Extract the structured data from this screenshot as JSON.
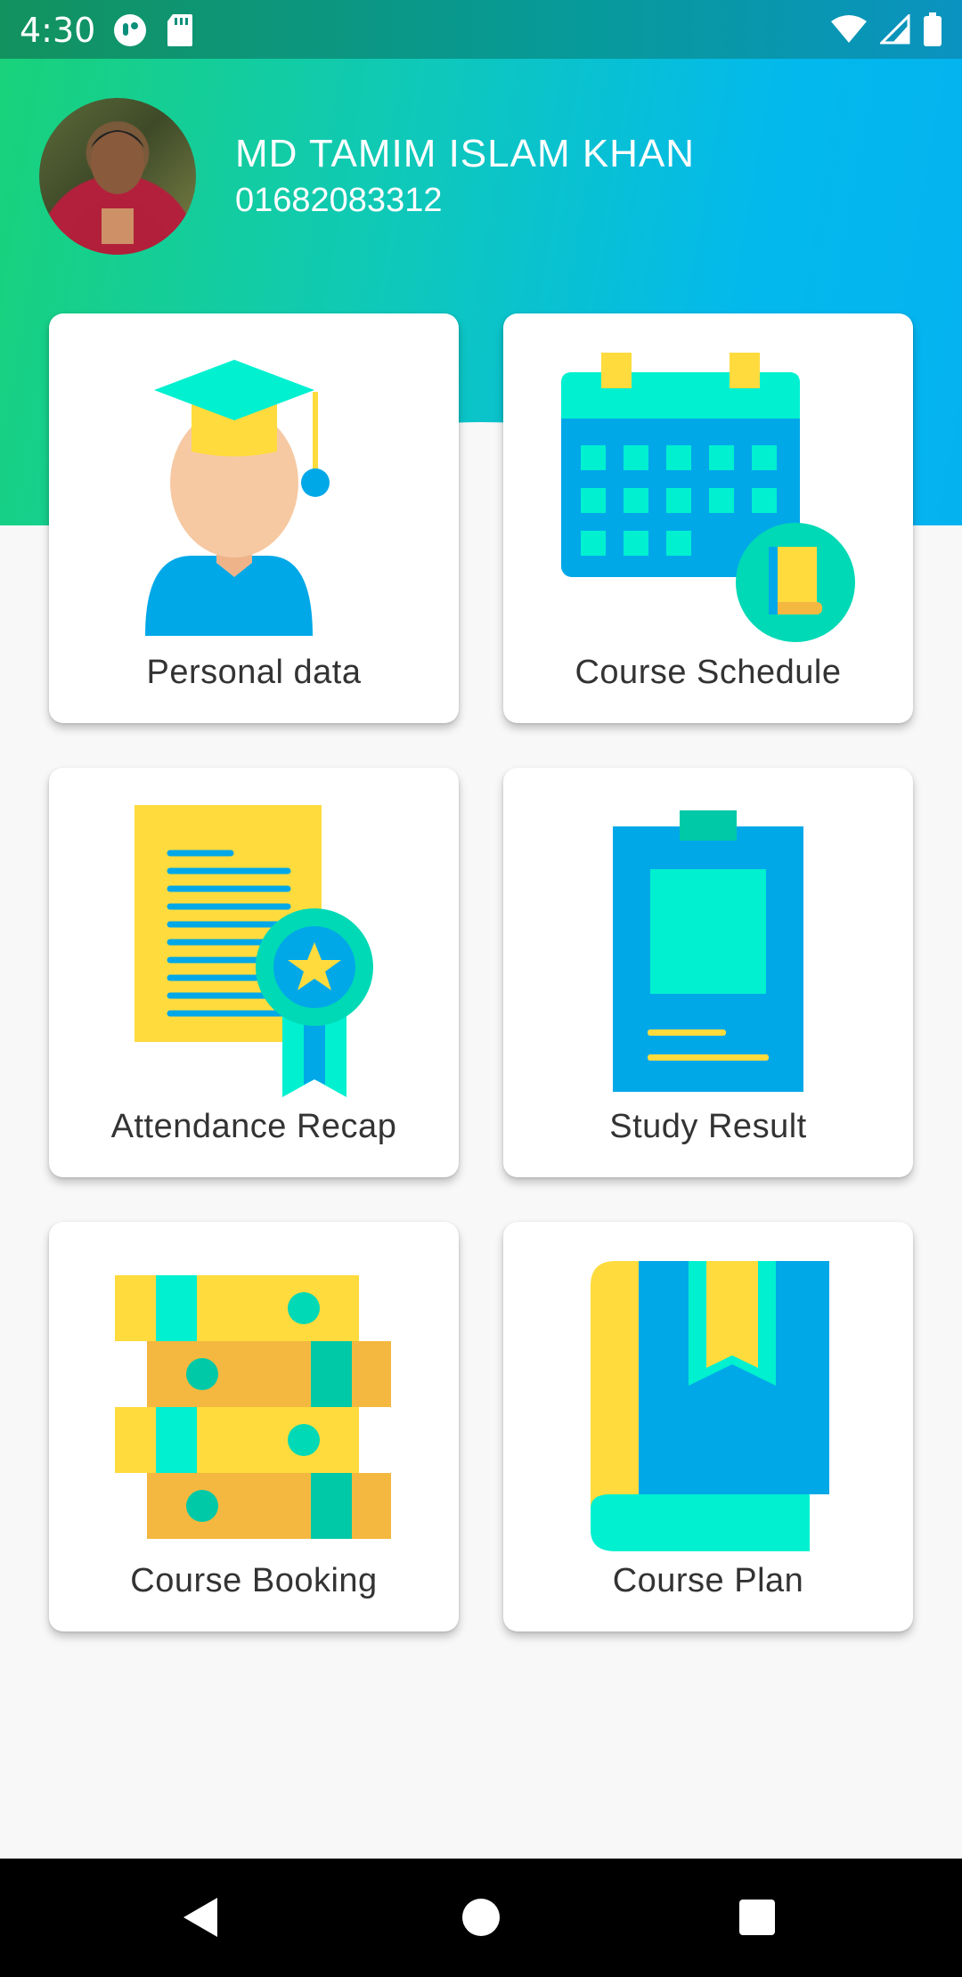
{
  "status_bar": {
    "time": "4:30",
    "left_icons": [
      "notification-app-icon",
      "sd-card-icon"
    ],
    "right_icons": [
      "wifi-icon",
      "cell-signal-icon",
      "battery-icon"
    ]
  },
  "profile": {
    "name": "MD TAMIM ISLAM KHAN",
    "phone": "01682083312"
  },
  "menu": {
    "items": [
      {
        "label": "Personal data",
        "icon": "graduate-icon"
      },
      {
        "label": "Course Schedule",
        "icon": "calendar-icon"
      },
      {
        "label": "Attendance Recap",
        "icon": "certificate-icon"
      },
      {
        "label": "Study Result",
        "icon": "clipboard-icon"
      },
      {
        "label": "Course Booking",
        "icon": "books-stack-icon"
      },
      {
        "label": "Course Plan",
        "icon": "book-bookmark-icon"
      }
    ]
  },
  "nav": {
    "buttons": [
      "back-button",
      "home-button",
      "recents-button"
    ]
  },
  "colors": {
    "header_start": "#19d27a",
    "header_end": "#04b2f0",
    "icon_blue": "#00a8e8",
    "icon_teal": "#00f0d0",
    "icon_yellow": "#ffdb3e",
    "icon_orange": "#f4b840"
  }
}
